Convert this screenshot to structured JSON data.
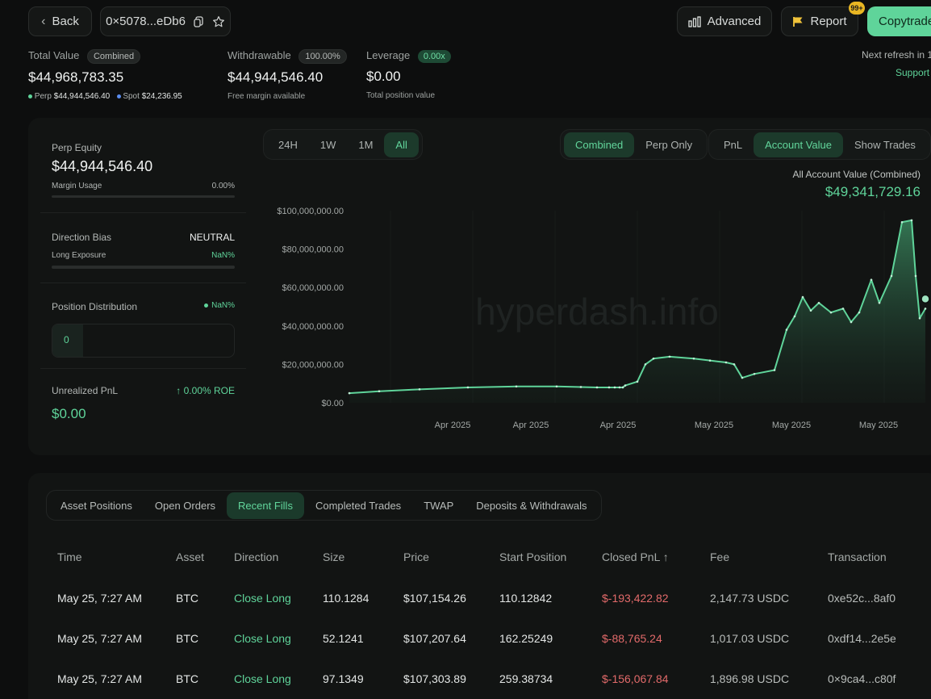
{
  "header": {
    "back_label": "Back",
    "address": "0×5078...eDb6",
    "advanced_label": "Advanced",
    "report_label": "Report",
    "notification_badge": "99+",
    "copytrade_label": "Copytrade"
  },
  "summary": {
    "total_value_label": "Total Value",
    "total_value_badge": "Combined",
    "total_value": "$44,968,783.35",
    "perp_label": "Perp",
    "perp_value": "$44,944,546.40",
    "spot_label": "Spot",
    "spot_value": "$24,236.95",
    "withdrawable_label": "Withdrawable",
    "withdrawable_badge": "100.00%",
    "withdrawable_value": "$44,944,546.40",
    "withdrawable_sub": "Free margin available",
    "leverage_label": "Leverage",
    "leverage_badge": "0.00x",
    "leverage_value": "$0.00",
    "leverage_sub": "Total position value",
    "refresh_text": "Next refresh in 1",
    "support_label": "Support"
  },
  "left_panel": {
    "perp_equity_label": "Perp Equity",
    "perp_equity_value": "$44,944,546.40",
    "margin_usage_label": "Margin Usage",
    "margin_usage_value": "0.00%",
    "direction_bias_label": "Direction Bias",
    "direction_bias_value": "NEUTRAL",
    "long_exposure_label": "Long Exposure",
    "long_exposure_value": "NaN%",
    "position_distribution_label": "Position Distribution",
    "position_distribution_value": "NaN%",
    "position_count": "0",
    "unrealized_pnl_label": "Unrealized PnL",
    "roe_text": "↑ 0.00% ROE",
    "unrealized_pnl_value": "$0.00"
  },
  "chart_controls": {
    "ranges": [
      "24H",
      "1W",
      "1M",
      "All"
    ],
    "active_range": "All",
    "modes": [
      "Combined",
      "Perp Only"
    ],
    "active_mode": "Combined",
    "metrics": [
      "PnL",
      "Account Value",
      "Show Trades"
    ],
    "active_metric": "Account Value",
    "summary_label": "All Account Value (Combined)",
    "summary_value": "$49,341,729.16",
    "watermark": "hyperdash.info"
  },
  "chart_data": {
    "type": "area",
    "ylim": [
      0,
      100000000
    ],
    "yticks": [
      "$100,000,000.00",
      "$80,000,000.00",
      "$60,000,000.00",
      "$40,000,000.00",
      "$20,000,000.00",
      "$0.00"
    ],
    "xticks": [
      "Apr 2025",
      "Apr 2025",
      "Apr 2025",
      "May 2025",
      "May 2025",
      "May 2025"
    ],
    "series": [
      {
        "values": [
          5000000,
          6000000,
          7000000,
          8000000,
          8500000,
          8500000,
          8200000,
          8000000,
          8000000,
          8000000,
          8000000,
          8000000,
          9000000,
          11000000,
          20000000,
          23000000,
          24000000,
          23000000,
          22000000,
          21000000,
          20000000,
          13000000,
          15000000,
          17000000,
          38000000,
          45000000,
          55000000,
          48000000,
          52000000,
          47000000,
          49000000,
          42000000,
          47000000,
          64000000,
          52000000,
          66000000,
          94000000,
          95000000,
          66000000,
          44000000,
          49000000
        ]
      }
    ],
    "grid": true
  },
  "table": {
    "tabs": [
      "Asset Positions",
      "Open Orders",
      "Recent Fills",
      "Completed Trades",
      "TWAP",
      "Deposits & Withdrawals"
    ],
    "active_tab": "Recent Fills",
    "headers": [
      "Time",
      "Asset",
      "Direction",
      "Size",
      "Price",
      "Start Position",
      "Closed PnL ↑",
      "Fee",
      "Transaction"
    ],
    "rows": [
      [
        "May 25, 7:27 AM",
        "BTC",
        "Close Long",
        "110.1284",
        "$107,154.26",
        "110.12842",
        "$-193,422.82",
        "2,147.73 USDC",
        "0xe52c...8af0"
      ],
      [
        "May 25, 7:27 AM",
        "BTC",
        "Close Long",
        "52.1241",
        "$107,207.64",
        "162.25249",
        "$-88,765.24",
        "1,017.03 USDC",
        "0xdf14...2e5e"
      ],
      [
        "May 25, 7:27 AM",
        "BTC",
        "Close Long",
        "97.1349",
        "$107,303.89",
        "259.38734",
        "$-156,067.84",
        "1,896.98 USDC",
        "0×9ca4...c80f"
      ]
    ]
  },
  "colors": {
    "accent": "#5fd49a",
    "negative": "#e26a6a",
    "background": "#0d0e0e"
  }
}
